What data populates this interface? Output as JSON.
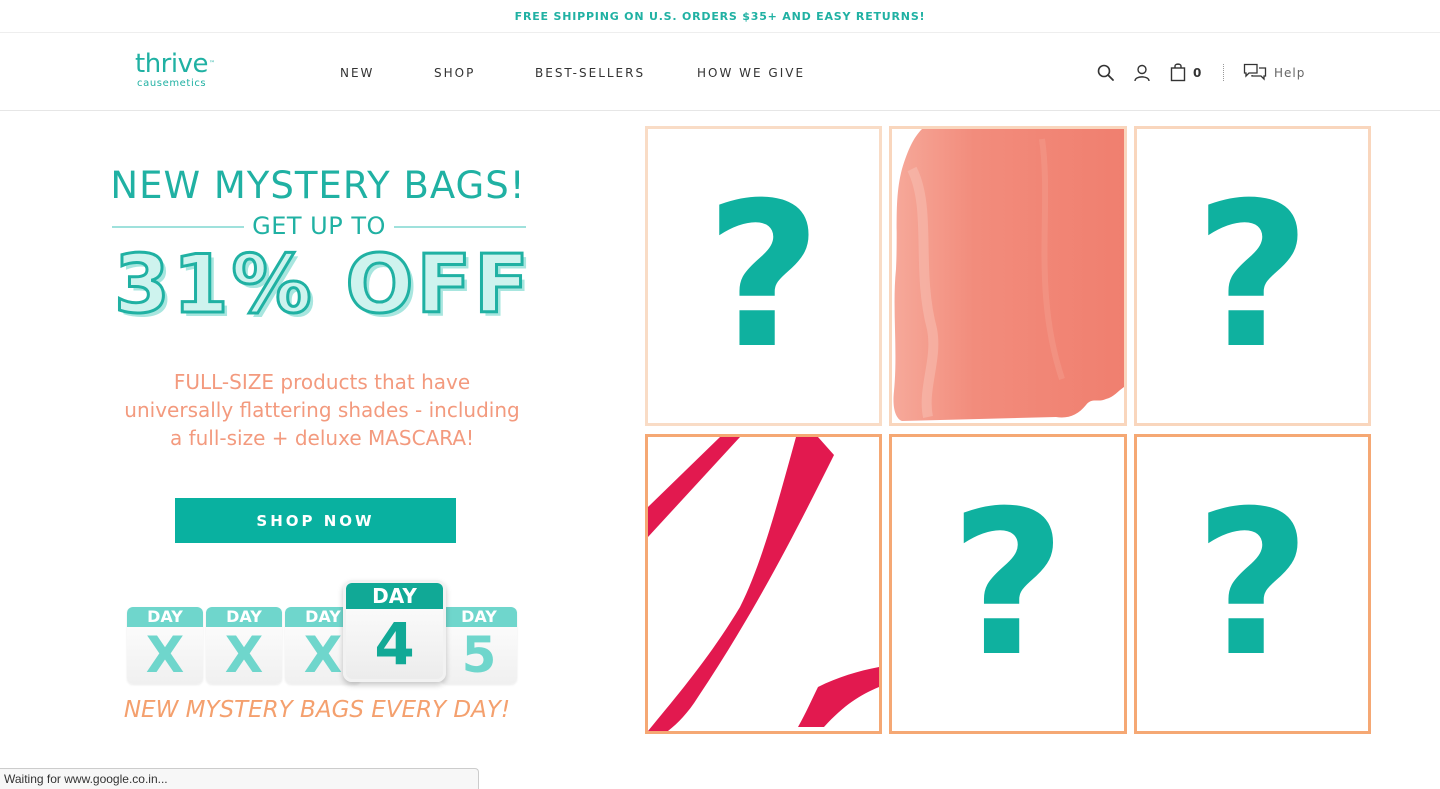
{
  "promo": {
    "text": "FREE SHIPPING ON U.S. ORDERS $35+ AND EASY RETURNS!"
  },
  "header": {
    "logo_main": "thrive",
    "logo_tm": "™",
    "logo_sub": "causemetics",
    "nav": [
      {
        "label": "NEW"
      },
      {
        "label": "SHOP"
      },
      {
        "label": "BEST-SELLERS"
      },
      {
        "label": "HOW WE GIVE"
      }
    ],
    "cart_count": "0",
    "help_label": "Help",
    "icons": [
      "search-icon",
      "account-icon",
      "shopping-bag-icon",
      "chat-help-icon"
    ]
  },
  "hero": {
    "title": "NEW MYSTERY BAGS!",
    "subtitle": "GET UP TO",
    "discount": "31% OFF",
    "description_lines": [
      "FULL-SIZE products that have",
      "universally flattering shades - including",
      "a full-size + deluxe MASCARA!"
    ],
    "cta_label": "SHOP NOW",
    "days": [
      {
        "cap": "DAY",
        "num": "X"
      },
      {
        "cap": "DAY",
        "num": "X"
      },
      {
        "cap": "DAY",
        "num": "X"
      },
      {
        "cap": "DAY",
        "num": "4",
        "active": true
      },
      {
        "cap": "DAY",
        "num": "5"
      }
    ],
    "tagline": "NEW MYSTERY BAGS EVERY DAY!"
  },
  "grid": {
    "tiles": [
      {
        "type": "mystery",
        "mark": "?"
      },
      {
        "type": "blush-swatch"
      },
      {
        "type": "mystery",
        "mark": "?"
      },
      {
        "type": "lip-liner-swatch"
      },
      {
        "type": "mystery",
        "mark": "?"
      },
      {
        "type": "mystery",
        "mark": "?"
      }
    ],
    "colors": {
      "accent": "#0fb19f",
      "border_top": "#f8d2b6",
      "border_bottom": "#f4a067",
      "blush": "#f3877a",
      "liner": "#e2194f"
    }
  },
  "status_bar": {
    "text": "Waiting for www.google.co.in..."
  }
}
